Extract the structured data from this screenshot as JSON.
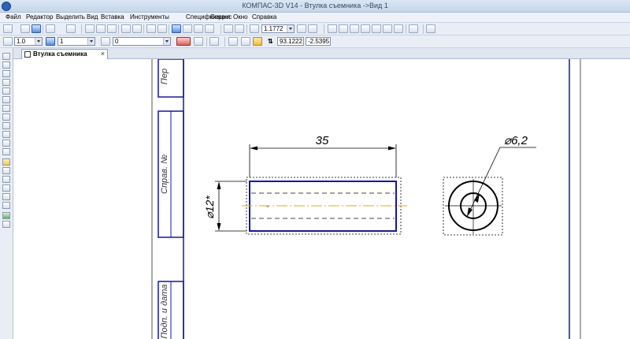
{
  "window": {
    "title": "КОМПАС-3D V14 - Втулка съемника ->Вид 1"
  },
  "menu": [
    "Файл",
    "Редактор",
    "Выделить",
    "Вид",
    "Вставка",
    "Инструменты",
    "Спецификация",
    "Сервис",
    "Окно",
    "Справка"
  ],
  "toolbar2": {
    "line_weight": "1.0",
    "view_number": "1",
    "layer_number": "0",
    "zoom": "1.1772",
    "coord_x": "93.1222",
    "coord_y": "-2.5395"
  },
  "tabs": [
    {
      "label": "Втулка съемника",
      "close": "×"
    }
  ],
  "drawing": {
    "frame_labels": {
      "top": "Пер",
      "middle": "Справ. №",
      "bottom": "Подп. и дата"
    },
    "dim_length": "35",
    "dim_outer_diameter": "⌀12*",
    "dim_inner_diameter": "⌀6,2"
  },
  "colors": {
    "geometry": "#1515a8",
    "axis": "#d8b400",
    "frame": "#1515a8"
  }
}
